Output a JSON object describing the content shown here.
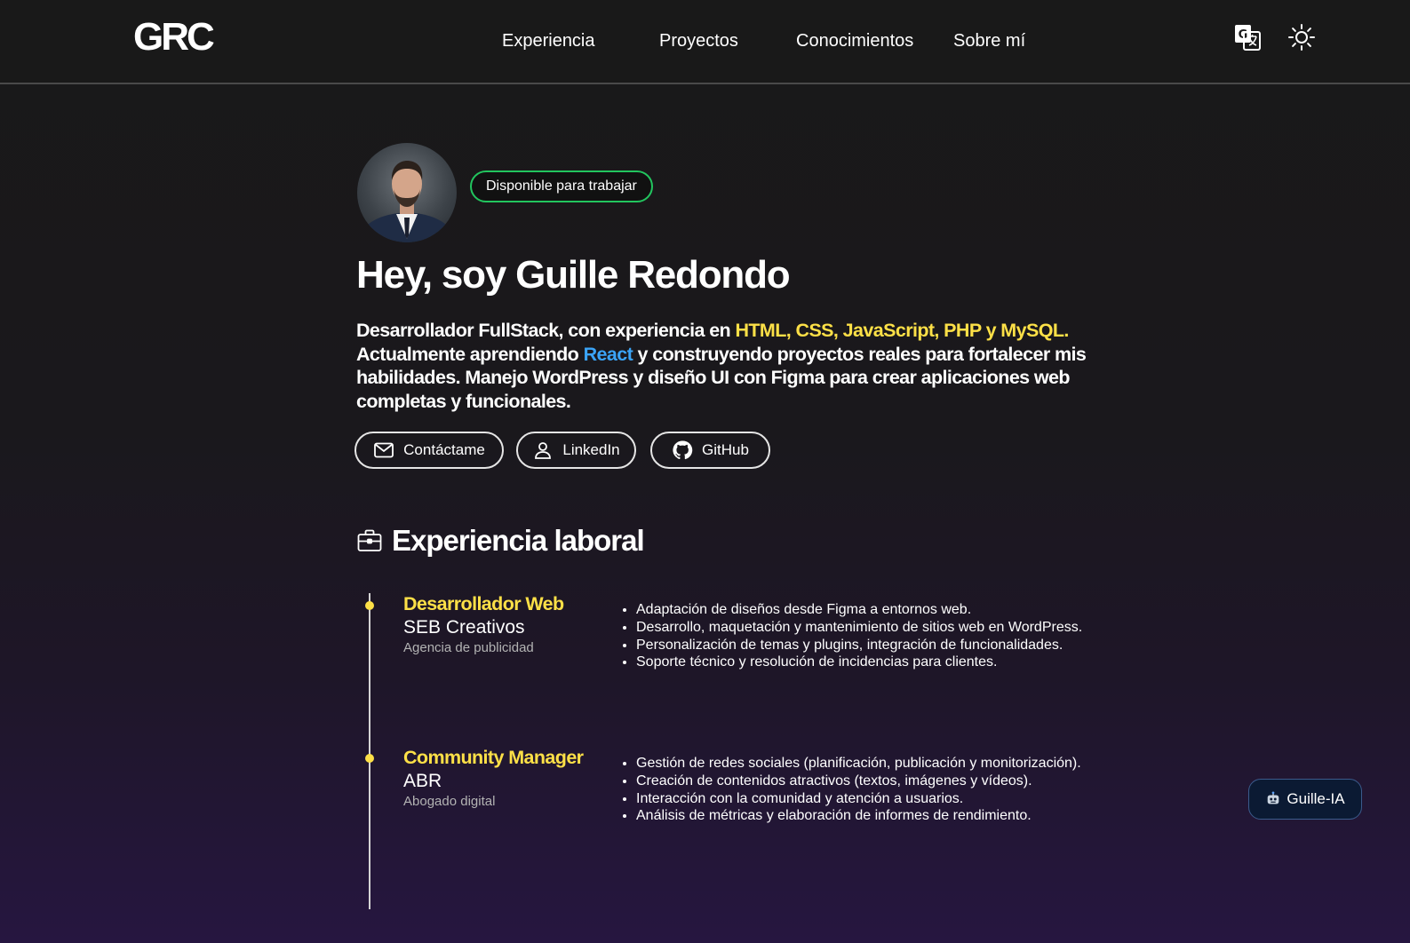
{
  "header": {
    "logo": "GRC",
    "nav": [
      "Experiencia",
      "Proyectos",
      "Conocimientos",
      "Sobre mí"
    ],
    "icons": [
      "translate-icon",
      "sun-icon"
    ]
  },
  "hero": {
    "badge": "Disponible para trabajar",
    "title": "Hey, soy Guille Redondo",
    "bio": {
      "p1": "Desarrollador FullStack, con experiencia en ",
      "tech": "HTML, CSS, JavaScript, PHP y MySQL",
      "p2": ".",
      "p3": "Actualmente aprendiendo ",
      "learning": "React",
      "p4": " y construyendo proyectos reales para fortalecer mis habilidades. Manejo WordPress y diseño UI con Figma para crear aplicaciones web completas y funcionales."
    },
    "buttons": {
      "contact": "Contáctame",
      "linkedin": "LinkedIn",
      "github": "GitHub"
    }
  },
  "experience": {
    "title": "Experiencia laboral",
    "jobs": [
      {
        "role": "Desarrollador Web",
        "company": "SEB Creativos",
        "type": "Agencia de publicidad",
        "tasks": [
          "Adaptación de diseños desde Figma a entornos web.",
          "Desarrollo, maquetación y mantenimiento de sitios web en WordPress.",
          "Personalización de temas y plugins, integración de funcionalidades.",
          "Soporte técnico y resolución de incidencias para clientes."
        ]
      },
      {
        "role": "Community Manager",
        "company": "ABR",
        "type": "Abogado digital",
        "tasks": [
          "Gestión de redes sociales (planificación, publicación y monitorización).",
          "Creación de contenidos atractivos (textos, imágenes y vídeos).",
          "Interacción con la comunidad y atención a usuarios.",
          "Análisis de métricas y elaboración de informes de rendimiento."
        ]
      }
    ]
  },
  "chat": {
    "label": "Guille-IA",
    "icon": "robot-icon"
  },
  "colors": {
    "accent_yellow": "#fde047",
    "accent_blue": "#3ba4f7",
    "available_green": "#22c55e",
    "chat_bg": "#0b1a33"
  }
}
